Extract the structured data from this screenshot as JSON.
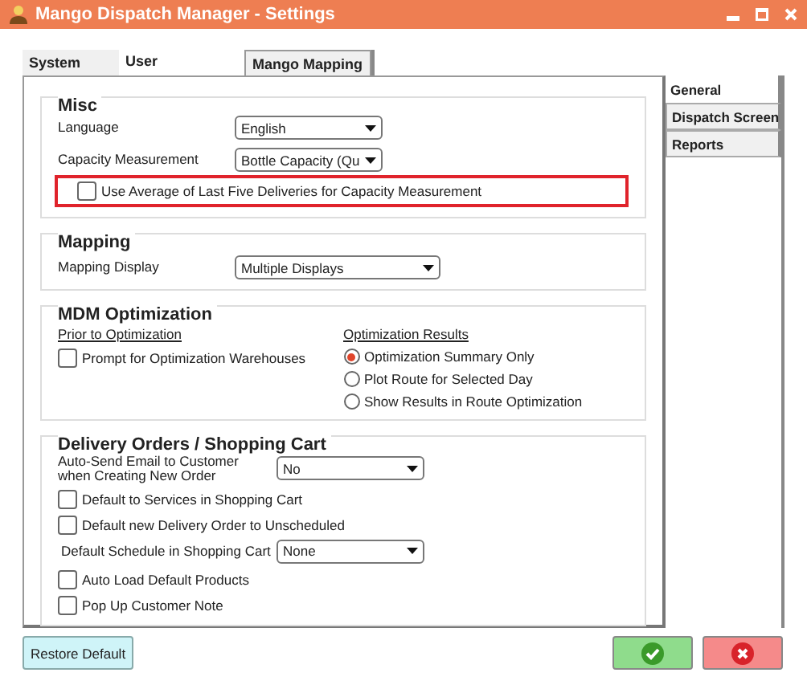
{
  "window": {
    "title": "Mango Dispatch Manager - Settings"
  },
  "top_tabs": [
    {
      "label": "System",
      "selected": false
    },
    {
      "label": "User",
      "selected": true
    },
    {
      "label": "Mango Mapping",
      "selected": false
    }
  ],
  "side_tabs": [
    {
      "label": "General",
      "selected": true
    },
    {
      "label": "Dispatch Screen",
      "selected": false
    },
    {
      "label": "Reports",
      "selected": false
    }
  ],
  "misc": {
    "heading": "Misc",
    "dropdowns": [
      {
        "label": "Language",
        "value": "English"
      },
      {
        "label": "Capacity Measurement",
        "value": "Bottle Capacity (Qu"
      }
    ],
    "checkbox": {
      "label": "Use Average of Last Five Deliveries for Capacity Measurement",
      "checked": false,
      "highlighted": true
    }
  },
  "mapping": {
    "heading": "Mapping",
    "dropdown": {
      "label": "Mapping Display",
      "value": "Multiple Displays"
    }
  },
  "optimization": {
    "heading": "MDM Optimization",
    "prior": {
      "heading": "Prior to Optimization",
      "checkboxes": [
        {
          "label": "Prompt for Optimization Warehouses",
          "checked": false
        }
      ]
    },
    "results": {
      "heading": "Optimization Results",
      "radios": [
        {
          "label": "Optimization Summary Only",
          "selected": true
        },
        {
          "label": "Plot Route for Selected Day",
          "selected": false
        },
        {
          "label": "Show Results in Route Optimization",
          "selected": false
        }
      ]
    }
  },
  "delivery": {
    "heading": "Delivery Orders / Shopping Cart",
    "items": [
      {
        "kind": "dropdown",
        "label": "Auto-Send Email to Customer\nwhen Creating New Order",
        "value": "No"
      },
      {
        "kind": "checkbox",
        "label": "Default to Services in Shopping Cart",
        "checked": false
      },
      {
        "kind": "checkbox",
        "label": "Default new Delivery Order to Unscheduled",
        "checked": false
      },
      {
        "kind": "dropdown",
        "label": "Default Schedule in Shopping Cart",
        "value": "None"
      },
      {
        "kind": "checkbox",
        "label": "Auto Load Default Products",
        "checked": false
      },
      {
        "kind": "checkbox",
        "label": "Pop Up Customer Note",
        "checked": false
      }
    ]
  },
  "buttons": {
    "restore": "Restore Default"
  }
}
